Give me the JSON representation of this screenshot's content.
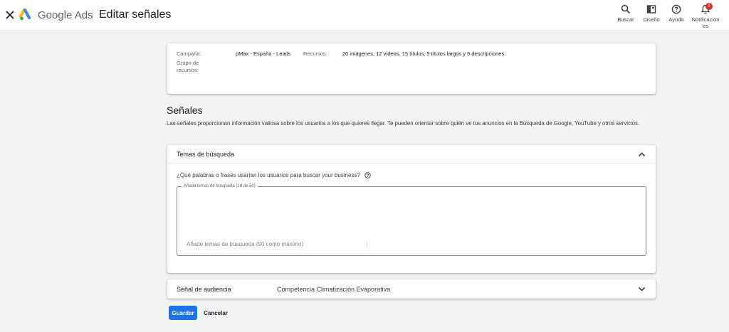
{
  "header": {
    "brand": "Google Ads",
    "page_title": "Editar señales",
    "tools": [
      {
        "icon": "search-icon",
        "label": "Buscar"
      },
      {
        "icon": "layout-icon",
        "label": "Diseño"
      },
      {
        "icon": "help-icon",
        "label": "Ayuda"
      },
      {
        "icon": "bell-icon",
        "label": "Notificaciones",
        "label_lines": [
          "Notificacion",
          "es"
        ],
        "badge": "!"
      }
    ]
  },
  "summary": {
    "campaign_label": "Campaña:",
    "campaign_value": "pMax - España - Leads",
    "asset_group_label": "Grupo de recursos:",
    "asset_group_lines": [
      "Grupo de",
      "recursos:"
    ],
    "resources_label": "Recursos:",
    "resources_value": "20 imágenes, 12 vídeos, 15 títulos, 5 títulos largos y 5 descripciones"
  },
  "signals": {
    "title": "Señales",
    "description": "Las señales proporcionan información valiosa sobre los usuarios a los que quieres llegar. Te pueden orientar sobre quién ve tus anuncios en la Búsqueda de Google, YouTube y otros servicios."
  },
  "search_topics": {
    "title": "Temas de búsqueda",
    "question": "¿Qué palabras o frases usarían los usuarios para buscar your business?",
    "field_label": "Añade temas de búsqueda (10 de 50)",
    "placeholder": "Añade temas de búsqueda (50 como máximo)"
  },
  "audience_signal": {
    "title": "Señal de audiencia",
    "value": "Competencia Climatización Evaporativa"
  },
  "actions": {
    "save_label": "Guardar",
    "cancel_label": "Cancelar"
  },
  "colors": {
    "primary": "#1a73e8",
    "badge": "#d93025",
    "background": "#f1f3f4"
  }
}
